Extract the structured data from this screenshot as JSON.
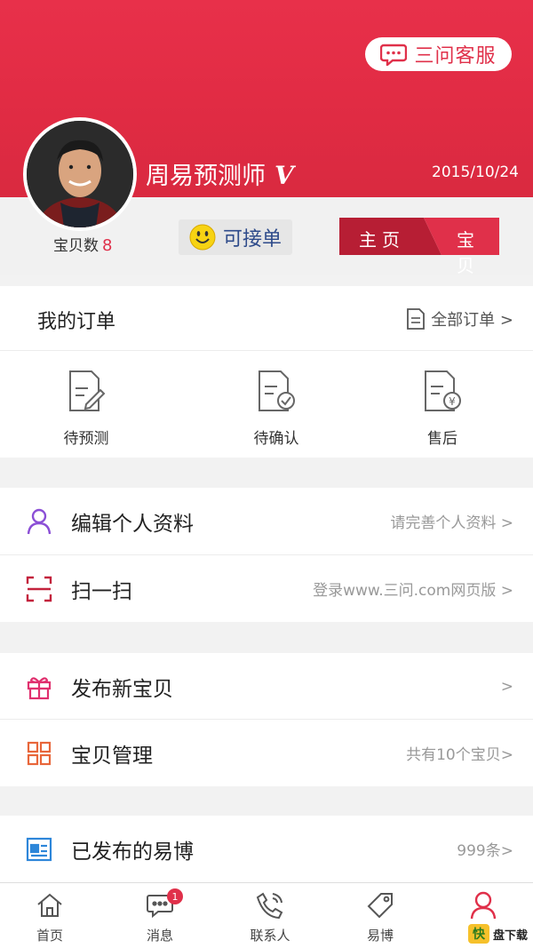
{
  "header": {
    "service_label": "三问客服",
    "name": "周易预测师",
    "verified_mark": "V",
    "date": "2015/10/24"
  },
  "profile": {
    "count_label": "宝贝数",
    "count_value": "8",
    "accept_label": "可接单",
    "tabs": [
      "主页",
      "宝贝"
    ]
  },
  "orders": {
    "title": "我的订单",
    "all_label": "全部订单 >",
    "items": [
      {
        "label": "待预测",
        "icon": "document-edit-icon"
      },
      {
        "label": "待确认",
        "icon": "document-check-icon"
      },
      {
        "label": "售后",
        "icon": "document-yen-icon"
      }
    ]
  },
  "menu": {
    "edit_profile": {
      "title": "编辑个人资料",
      "hint": "请完善个人资料 >"
    },
    "scan": {
      "title": "扫一扫",
      "hint": "登录www.三问.com网页版 >"
    },
    "publish": {
      "title": "发布新宝贝",
      "hint": ">"
    },
    "manage": {
      "title": "宝贝管理",
      "hint": "共有10个宝贝>"
    },
    "posts": {
      "title": "已发布的易博",
      "hint": "999条>"
    }
  },
  "tabbar": {
    "items": [
      {
        "label": "首页",
        "icon": "home-icon"
      },
      {
        "label": "消息",
        "icon": "chat-icon",
        "badge": "1"
      },
      {
        "label": "联系人",
        "icon": "phone-icon"
      },
      {
        "label": "易博",
        "icon": "tag-icon"
      },
      {
        "label": "",
        "icon": "person-icon"
      }
    ]
  },
  "watermark": {
    "text": "盘下载"
  },
  "colors": {
    "accent": "#e0304a",
    "dark_accent": "#b71e34",
    "link_blue": "#2d4a8a"
  }
}
